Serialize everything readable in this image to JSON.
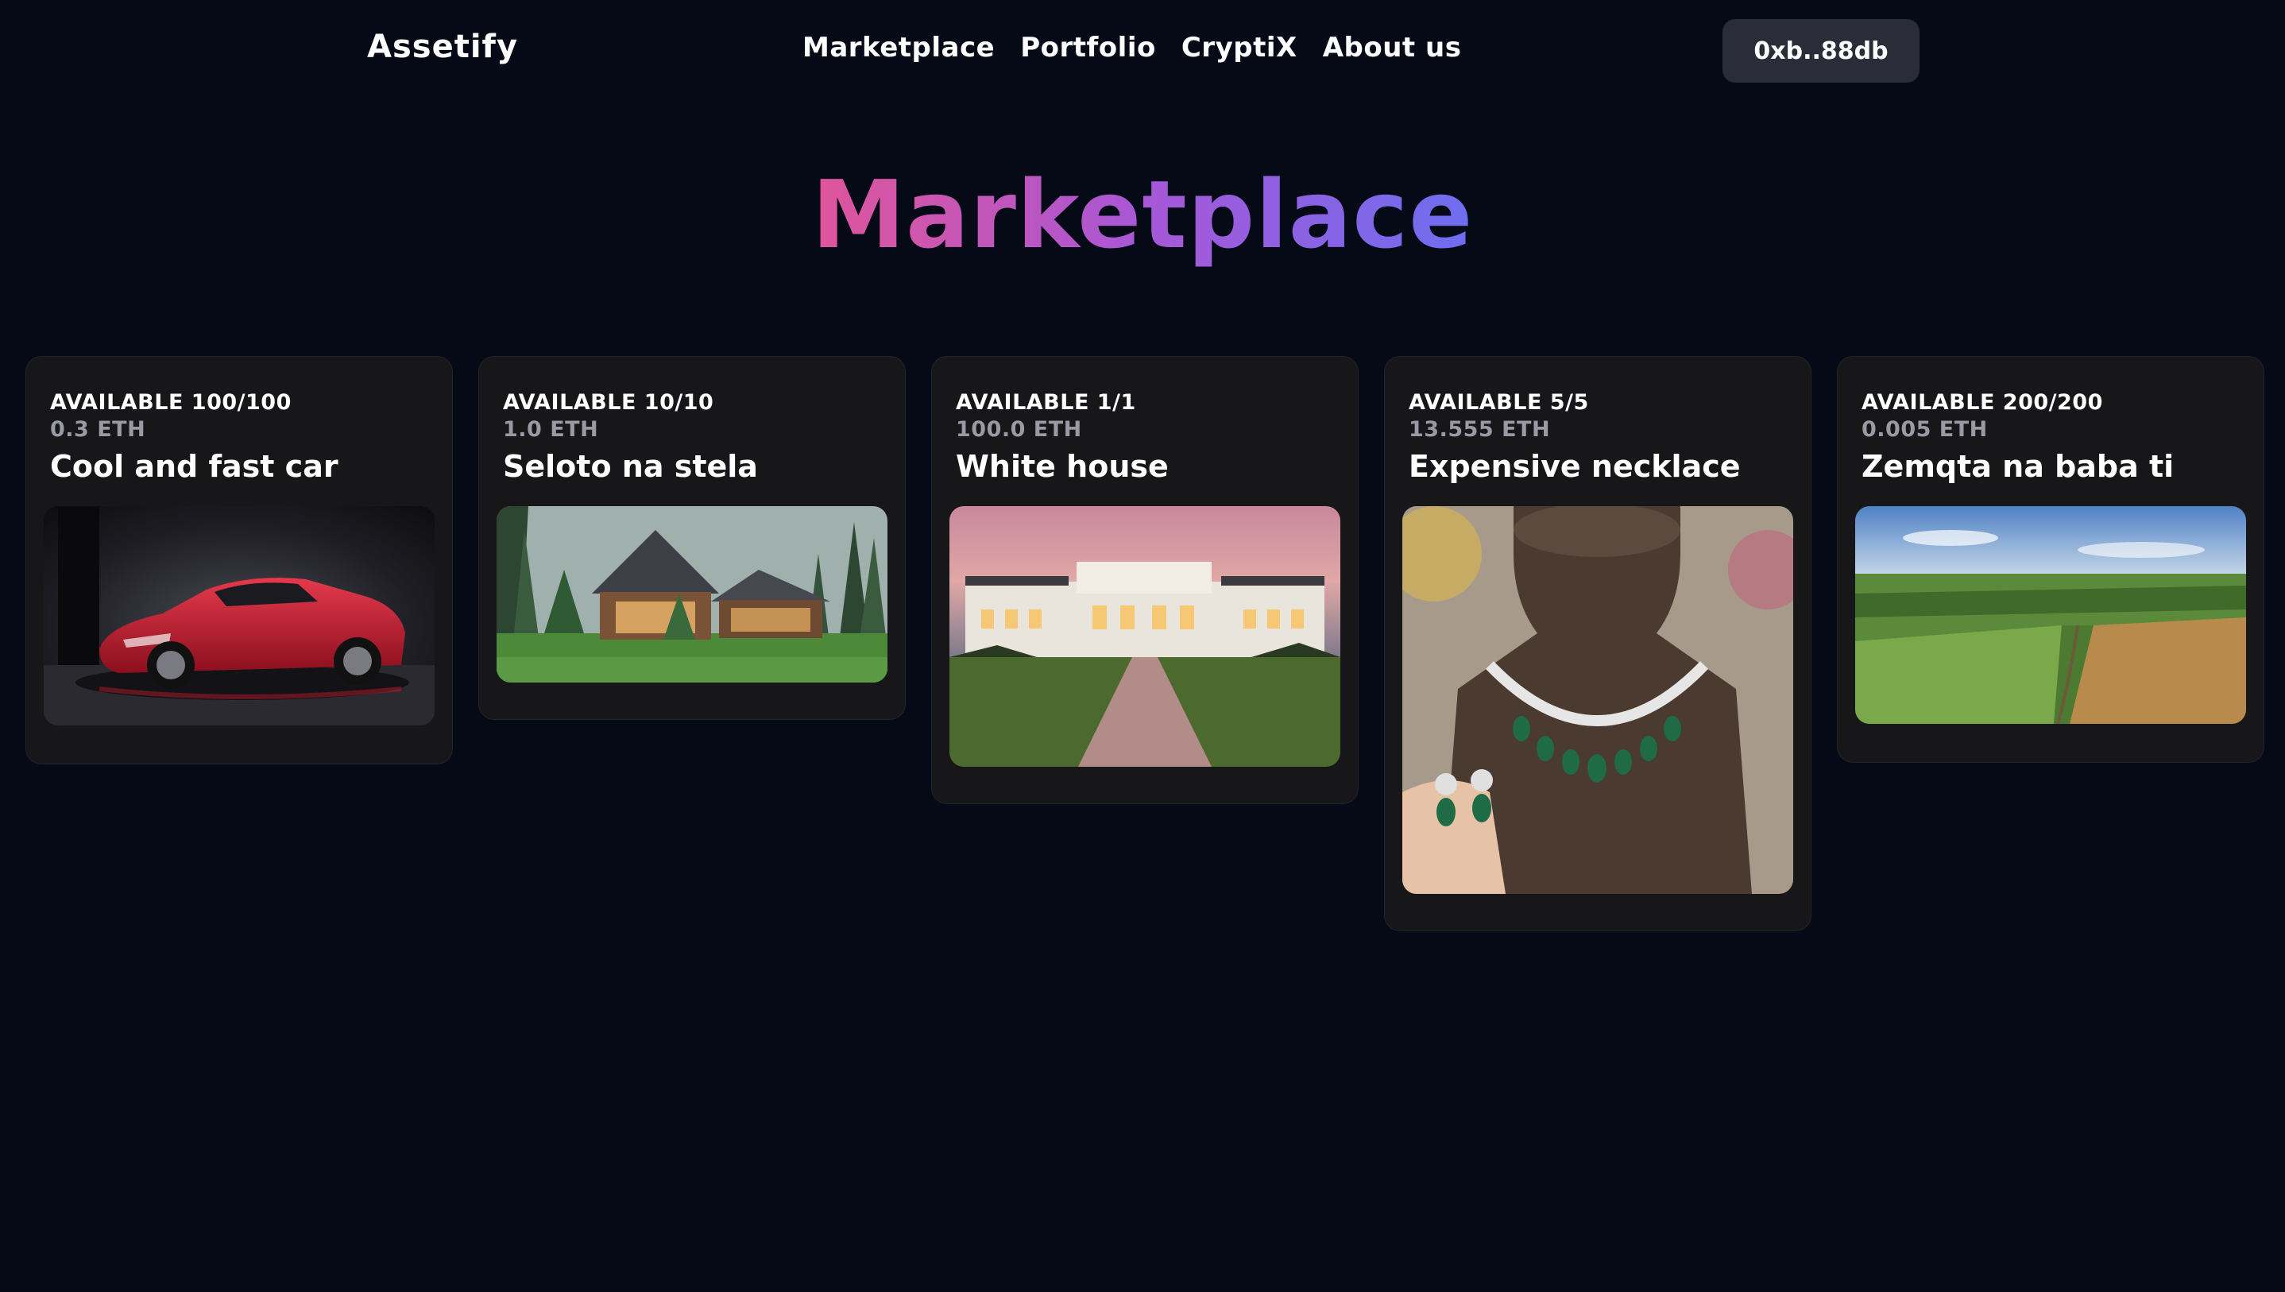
{
  "navbar": {
    "brand": "Assetify",
    "links": [
      "Marketplace",
      "Portfolio",
      "CryptiX",
      "About us"
    ],
    "wallet_label": "0xb..88db"
  },
  "page": {
    "title": "Marketplace"
  },
  "listings": [
    {
      "available": "AVAILABLE 100/100",
      "price": "0.3 ETH",
      "title": "Cool and fast car",
      "image": "red sports car in dark studio"
    },
    {
      "available": "AVAILABLE 10/10",
      "price": "1.0 ETH",
      "title": "Seloto na stela",
      "image": "wooden house in a pine forest"
    },
    {
      "available": "AVAILABLE 1/1",
      "price": "100.0 ETH",
      "title": "White house",
      "image": "white mansion at dusk with lawn and path"
    },
    {
      "available": "AVAILABLE 5/5",
      "price": "13.555 ETH",
      "title": "Expensive necklace",
      "image": "diamond and emerald necklace on a display bust"
    },
    {
      "available": "AVAILABLE 200/200",
      "price": "0.005 ETH",
      "title": "Zemqta na baba ti",
      "image": "aerial view of green and golden farmland"
    }
  ]
}
